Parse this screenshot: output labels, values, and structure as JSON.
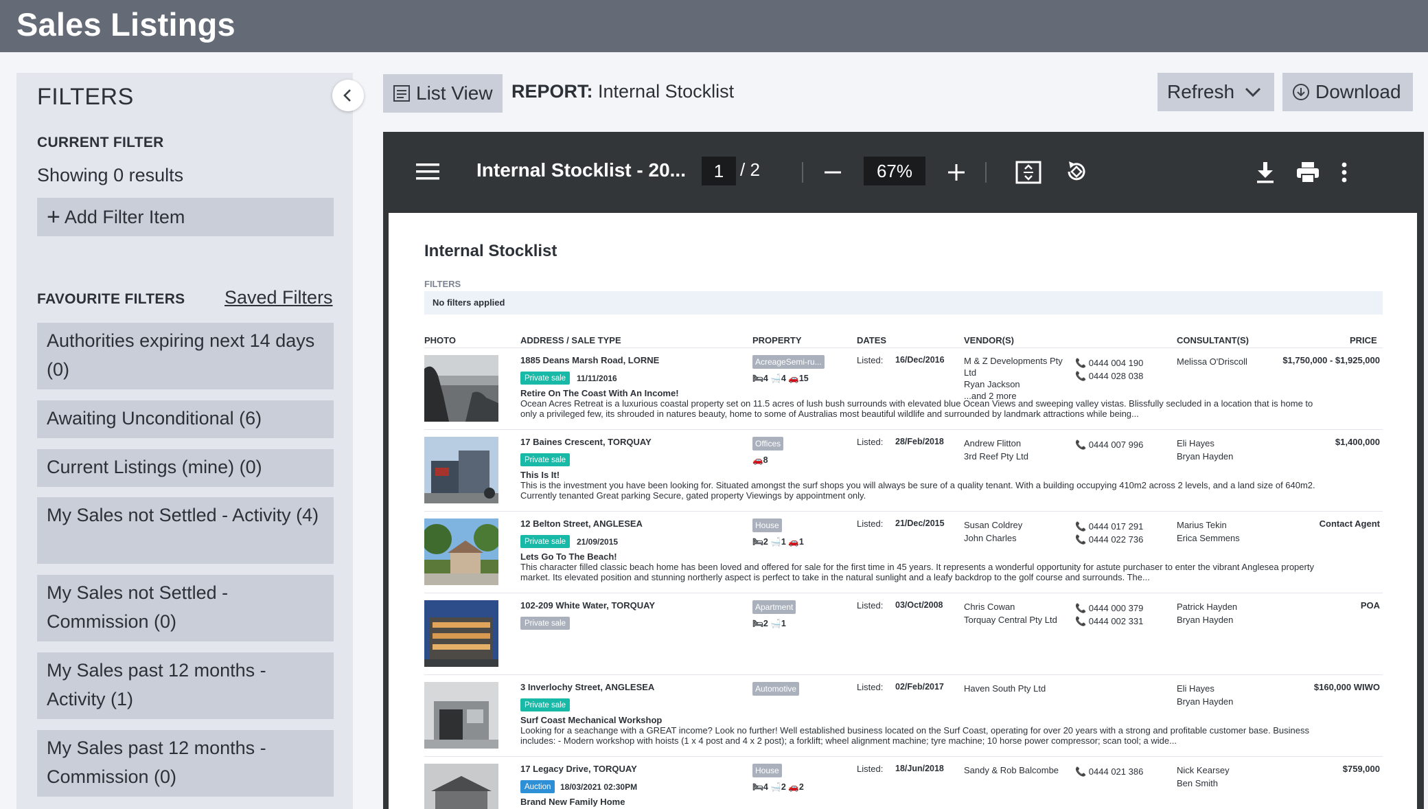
{
  "app": {
    "title": "Sales Listings"
  },
  "filters": {
    "title": "FILTERS",
    "current_filter_label": "CURRENT FILTER",
    "showing": "Showing 0 results",
    "add_filter": "Add Filter Item",
    "favourites_label": "FAVOURITE FILTERS",
    "saved_filters": "Saved Filters",
    "favourites": [
      "Authorities expiring next 14 days (0)",
      "Awaiting Unconditional (6)",
      "Current Listings (mine) (0)",
      "My Sales not Settled - Activity (4)",
      "My Sales not Settled - Commission (0)",
      "My Sales past 12 months - Activity (1)",
      "My Sales past 12 months - Commission (0)"
    ]
  },
  "toolbar": {
    "list_view": "List View",
    "report_label": "REPORT:",
    "report_name": "Internal Stocklist",
    "refresh": "Refresh",
    "download": "Download"
  },
  "viewer": {
    "doc_title": "Internal Stocklist - 20...",
    "page_current": "1",
    "page_total": "/ 2",
    "zoom": "67%"
  },
  "report": {
    "title": "Internal Stocklist",
    "filters_label": "FILTERS",
    "filters_value": "No filters applied",
    "columns": {
      "photo": "PHOTO",
      "address": "ADDRESS / SALE TYPE",
      "property": "PROPERTY",
      "dates": "DATES",
      "vendors": "VENDOR(S)",
      "consultants": "CONSULTANT(S)",
      "price": "PRICE"
    },
    "rows": [
      {
        "address": "1885 Deans Marsh Road, LORNE",
        "sale_type": "Private sale",
        "sale_date": "11/11/2016",
        "heading": "Retire On The Coast With An Income!",
        "description": "Ocean Acres Retreat is a luxurious coastal property set on 11.5 acres of lush bush surrounds with elevated blue Ocean Views and sweeping valley vistas. Blissfully secluded in a location that is home to only a privileged few, its shrouded in natures beauty, home to some of Australias most beautiful wildlife and surrounded by landmark attractions while being...",
        "property_type": "AcreageSemi-ru...",
        "features": "🛏4  🛁4  🚗15",
        "listed_label": "Listed:",
        "listed_date": "16/Dec/2016",
        "vendors": "M & Z Developments Pty Ltd\nRyan Jackson\n...and 2 more",
        "phones": "📞 0444 004 190\n📞 0444 028 038",
        "consultants": "Melissa O'Driscoll",
        "price": "$1,750,000 - $1,925,000"
      },
      {
        "address": "17 Baines Crescent, TORQUAY",
        "sale_type": "Private sale",
        "sale_date": "",
        "heading": "This Is It!",
        "description": "This is the investment you have been looking for. Situated amongst the surf shops you will always be sure of a quality tenant. With a building occupying 410m2 across 2 levels, and a land size of 640m2. Currently tenanted Great parking Secure, gated property Viewings by appointment only.",
        "property_type": "Offices",
        "features": "🚗8",
        "listed_label": "Listed:",
        "listed_date": "28/Feb/2018",
        "vendors": "Andrew Flitton\n3rd Reef Pty Ltd",
        "phones": "📞 0444 007 996",
        "consultants": "Eli Hayes\nBryan Hayden",
        "price": "$1,400,000"
      },
      {
        "address": "12 Belton Street, ANGLESEA",
        "sale_type": "Private sale",
        "sale_date": "21/09/2015",
        "heading": "Lets Go To The Beach!",
        "description": "This character filled classic beach home has been loved and offered for sale for the first time in 45 years. It represents a wonderful opportunity for astute purchaser to enter the vibrant Anglesea property market. Its elevated position and stunning northerly aspect is perfect to take in the natural sunlight and a leafy backdrop to the golf course and surrounds. The...",
        "property_type": "House",
        "features": "🛏2  🛁1  🚗1",
        "listed_label": "Listed:",
        "listed_date": "21/Dec/2015",
        "vendors": "Susan Coldrey\nJohn Charles",
        "phones": "📞 0444 017 291\n📞 0444 022 736",
        "consultants": "Marius Tekin\nErica Semmens",
        "price": "Contact Agent"
      },
      {
        "address": "102-209 White Water, TORQUAY",
        "sale_type": "Private sale",
        "sale_date": "",
        "heading": "",
        "description": "",
        "property_type": "Apartment",
        "features": "🛏2  🛁1",
        "listed_label": "Listed:",
        "listed_date": "03/Oct/2008",
        "vendors": "Chris Cowan\nTorquay Central Pty Ltd",
        "phones": "📞 0444 000 379\n📞 0444 002 331",
        "consultants": "Patrick Hayden\nBryan Hayden",
        "price": "POA"
      },
      {
        "address": "3 Inverlochy Street, ANGLESEA",
        "sale_type": "Private sale",
        "sale_date": "",
        "heading": "Surf Coast Mechanical Workshop",
        "description": "Looking for a seachange with a GREAT income? Look no further! Well established business located on the Surf Coast, operating for over 20 years with a strong and profitable customer base. Business includes: - Modern workshop with hoists (1 x 4 post and 4 x 2 post); a forklift; wheel alignment machine; tyre machine; 10 horse power compressor; scan tool; a wide...",
        "property_type": "Automotive",
        "features": "",
        "listed_label": "Listed:",
        "listed_date": "02/Feb/2017",
        "vendors": "Haven South Pty Ltd",
        "phones": "",
        "consultants": "Eli Hayes\nBryan Hayden",
        "price": "$160,000 WIWO"
      },
      {
        "address": "17 Legacy Drive, TORQUAY",
        "sale_type": "Auction",
        "sale_date": "18/03/2021 02:30PM",
        "heading": "Brand New Family Home",
        "description": "",
        "property_type": "House",
        "features": "🛏4  🛁2  🚗2",
        "listed_label": "Listed:",
        "listed_date": "18/Jun/2018",
        "vendors": "Sandy & Rob Balcombe",
        "phones": "📞 0444 021 386",
        "consultants": "Nick Kearsey\nBen Smith",
        "price": "$759,000"
      }
    ]
  },
  "colors": {
    "topbar": "#646b76",
    "sidebar": "#e3e6ec",
    "button": "#c9ced8",
    "viewer": "#323639",
    "private_sale": "#19b9a7",
    "auction": "#2d8fd6",
    "private_sale_muted": "#aab1bd"
  }
}
